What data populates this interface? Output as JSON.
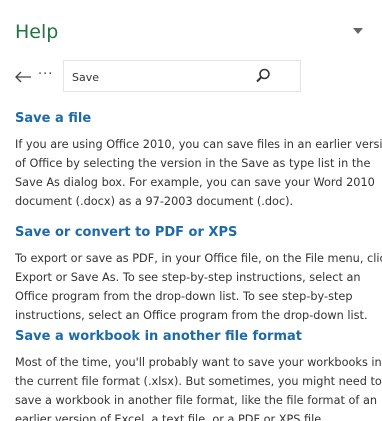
{
  "pane": {
    "title": "Help",
    "accent_color": "#217346",
    "link_color": "#1e6aa6"
  },
  "toolbar": {
    "more_label": "···",
    "search_value": "Save"
  },
  "icons": {
    "back": "arrow-left-icon",
    "search": "magnifier-icon",
    "collapse": "chevron-down-icon"
  },
  "results": [
    {
      "title": "Save a file",
      "lines": [
        "If you are using Office 2010, you can save files in an earlier version",
        "of Office by selecting the version in the Save as type list in the",
        "Save As dialog box. For example, you can save your Word 2010",
        "document (.docx) as a 97-2003 document (.doc)."
      ]
    },
    {
      "title": "Save or convert to PDF or XPS",
      "lines": [
        "To export or save as PDF, in your Office file, on the File menu, click",
        "Export or Save As. To see step-by-step instructions, select an",
        "Office program from the drop-down list. To see step-by-step",
        "instructions, select an Office program from the drop-down list."
      ]
    },
    {
      "title": "Save a workbook in another file format",
      "lines": [
        "Most of the time, you'll probably want to save your workbooks in",
        "the current file format (.xlsx). But sometimes, you might need to",
        "save a workbook in another file format, like the file format of an",
        "earlier version of Excel, a text file, or a PDF or XPS file."
      ]
    }
  ]
}
